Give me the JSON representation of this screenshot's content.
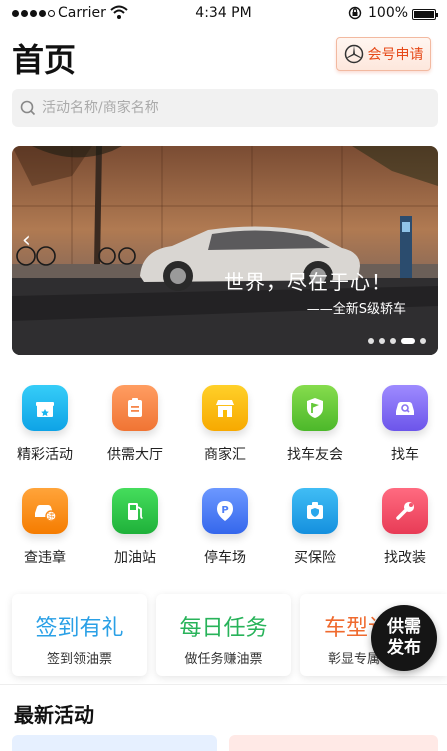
{
  "status_bar": {
    "carrier": "Carrier",
    "time": "4:34 PM",
    "battery": "100%"
  },
  "header": {
    "title": "首页",
    "apply_button": "会号申请",
    "apply_icon": "mercedes-star-icon",
    "accent_color": "#e64a19"
  },
  "search": {
    "placeholder": "活动名称/商家名称"
  },
  "banner": {
    "slogan": "世界，尽在于心！",
    "subtitle": "——全新S级轿车",
    "slide_count": 5,
    "active_slide": 4
  },
  "grid": {
    "items": [
      {
        "label": "精彩活动",
        "icon": "gift-icon",
        "color": "#18b6f0"
      },
      {
        "label": "供需大厅",
        "icon": "clipboard-icon",
        "color": "#f5864a"
      },
      {
        "label": "商家汇",
        "icon": "shop-icon",
        "color": "#fbbc05"
      },
      {
        "label": "找车友会",
        "icon": "flag-shield-icon",
        "color": "#66c93a"
      },
      {
        "label": "找车",
        "icon": "car-search-icon",
        "color": "#8a73f2"
      },
      {
        "label": "查违章",
        "icon": "car-violation-icon",
        "color": "#fb8c1a"
      },
      {
        "label": "加油站",
        "icon": "fuel-pump-icon",
        "color": "#2fc94a"
      },
      {
        "label": "停车场",
        "icon": "parking-icon",
        "color": "#4d7ef7"
      },
      {
        "label": "买保险",
        "icon": "insurance-icon",
        "color": "#2aa7ec"
      },
      {
        "label": "找改装",
        "icon": "wrench-icon",
        "color": "#f2536b"
      }
    ]
  },
  "cards": [
    {
      "title": "签到有礼",
      "subtitle": "签到领油票",
      "color": "#2aa0e6"
    },
    {
      "title": "每日任务",
      "subtitle": "做任务赚油票",
      "color": "#28b35a"
    },
    {
      "title": "车型认",
      "subtitle": "彰显专属",
      "color": "#ef6a2e"
    }
  ],
  "fab": {
    "line1": "供需",
    "line2": "发布"
  },
  "section": {
    "title": "最新活动"
  }
}
